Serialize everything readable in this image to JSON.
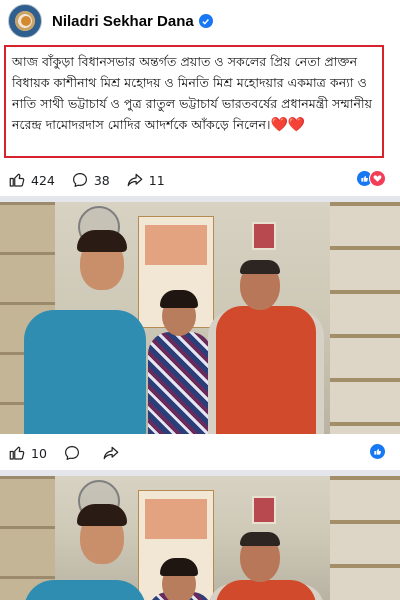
{
  "post": {
    "author": "Niladri Sekhar Dana",
    "caption": "আজ বাঁকুড়া বিধানসভার অন্তর্গত প্রয়াত ও সকলের প্রিয় নেতা প্রাক্তন বিধায়ক কাশীনাথ মিশ্র মহোদয় ও মিনতি মিশ্র মহোদয়ার একমাত্র কন্যা ও নাতি সাথী ভট্টাচার্য ও পুত্র রাতুল ভট্টাচার্য ভারতবর্ষের প্রধানমন্ত্রী সম্মানীয় নরেন্দ্র দামোদরদাস মোদির আদর্শকে আঁকড়ে নিলেন।",
    "hearts": "❤️❤️",
    "stats": {
      "likes": "424",
      "comments": "38",
      "shares": "11"
    }
  },
  "shared_post": {
    "stats": {
      "likes": "10"
    }
  },
  "icons": {
    "avatar": "profile-avatar",
    "verified": "verified-badge-icon",
    "like": "thumbs-up-icon",
    "comment": "comment-bubble-icon",
    "share": "share-arrow-icon",
    "reaction_like": "like-reaction-icon",
    "reaction_love": "love-reaction-icon"
  },
  "colors": {
    "highlight_border": "#d8232f",
    "facebook_blue": "#1877f2",
    "love_red": "#f33e58"
  }
}
